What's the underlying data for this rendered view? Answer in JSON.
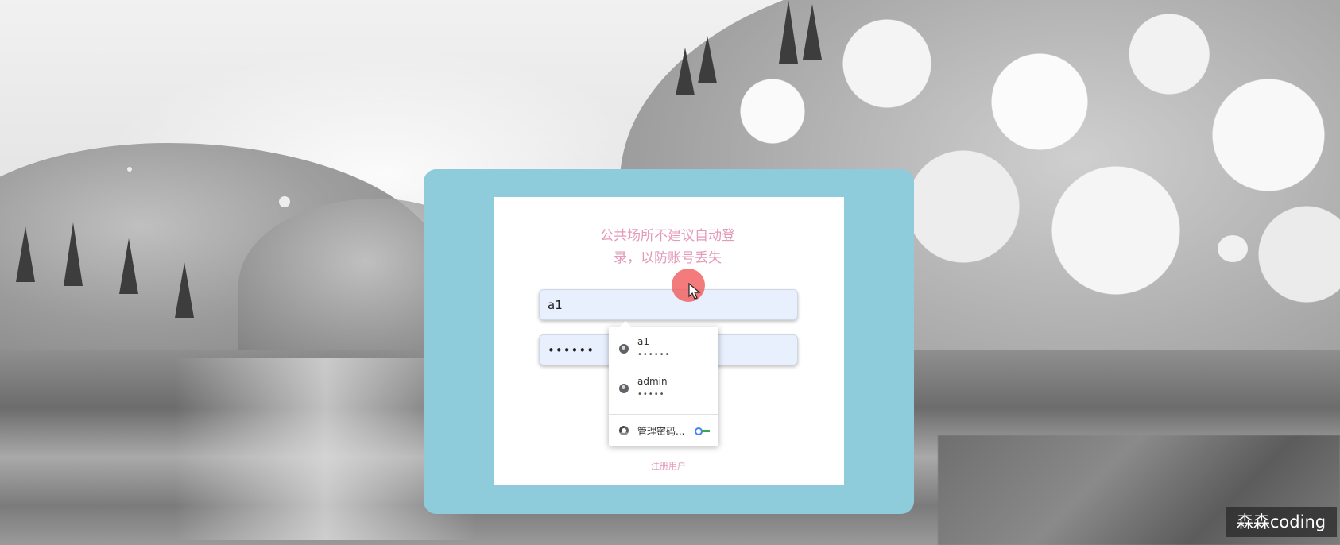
{
  "login": {
    "notice": "公共场所不建议自动登录，以防账号丢失",
    "username_value": "a1",
    "password_value": "••••••",
    "register_link": "注册用户"
  },
  "autofill": {
    "items": [
      {
        "username": "a1",
        "password_mask": "••••••"
      },
      {
        "username": "admin",
        "password_mask": "•••••"
      }
    ],
    "manage_label": "管理密码..."
  },
  "watermark": "森森coding",
  "colors": {
    "panel": "#8ecbdb",
    "notice_text": "#e49ab9",
    "input_bg": "#e8f0fe",
    "click_highlight": "#f05a5a"
  },
  "icons": {
    "account_icon": "globe-icon",
    "manage_icon": "chrome-icon",
    "key_icon": "key-icon",
    "cursor": "mouse-pointer-icon"
  }
}
